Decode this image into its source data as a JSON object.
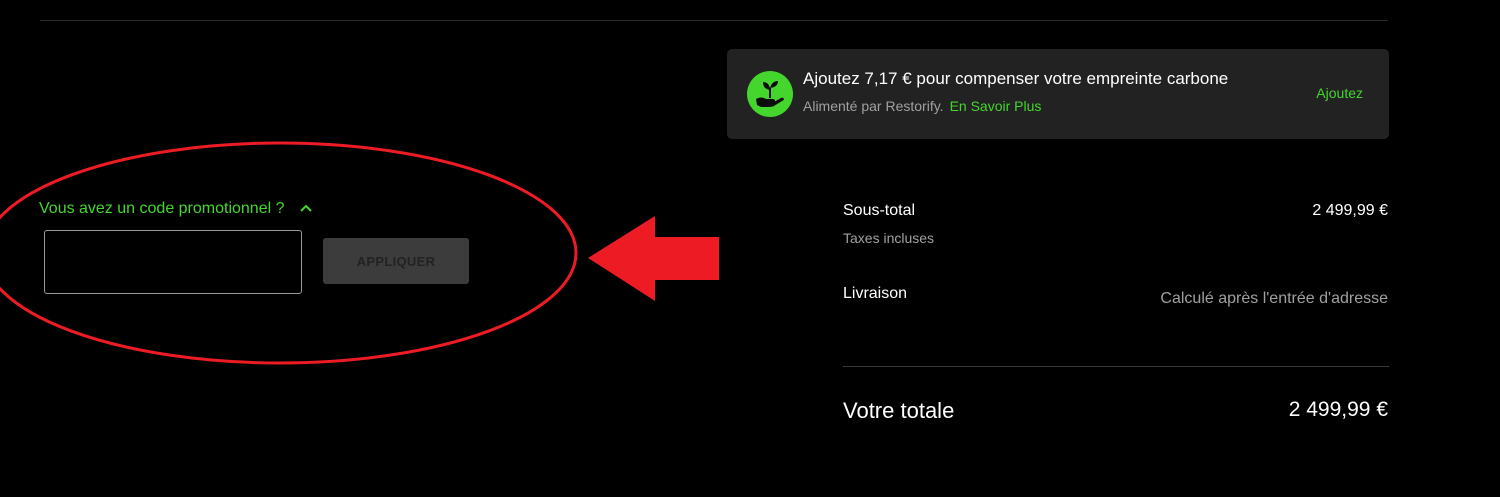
{
  "colors": {
    "background": "#000000",
    "accent_green": "#44d62c",
    "card_background": "#222222",
    "muted_text": "#a0a0a0",
    "annotation_red": "#ed1c24"
  },
  "carbon_offset": {
    "title": "Ajoutez 7,17 € pour compenser votre empreinte carbone",
    "powered_by": "Alimenté par Restorify.",
    "learn_more": "En Savoir Plus",
    "add_label": "Ajoutez",
    "icon": "plant-in-hand-icon"
  },
  "promo": {
    "toggle_label": "Vous avez un code promotionnel ?",
    "toggle_icon": "chevron-up-icon",
    "input_value": "",
    "input_placeholder": "",
    "apply_label": "APPLIQUER"
  },
  "summary": {
    "subtotal_label": "Sous-total",
    "subtotal_value": "2 499,99 €",
    "taxes_note": "Taxes incluses",
    "shipping_label": "Livraison",
    "shipping_value": "Calculé après l'entrée d'adresse",
    "total_label": "Votre totale",
    "total_value": "2 499,99 €"
  },
  "annotation": {
    "shapes": [
      "red-ellipse",
      "red-arrow-left"
    ]
  }
}
